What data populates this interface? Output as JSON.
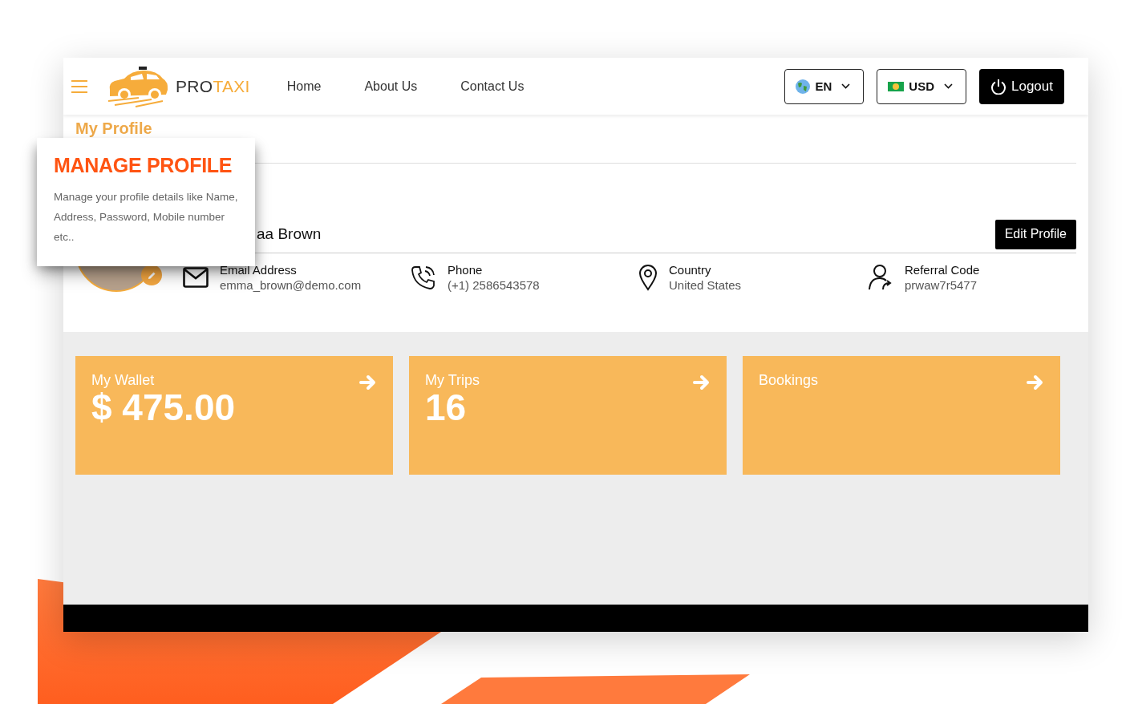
{
  "header": {
    "brand": {
      "part_1": "PRO",
      "part_2": "TAXI"
    },
    "nav": [
      "Home",
      "About Us",
      "Contact Us"
    ],
    "language": "EN",
    "currency": "USD",
    "logout": "Logout"
  },
  "page_title": "My Profile",
  "profile": {
    "name": "aa Brown",
    "edit_button": "Edit Profile",
    "details": [
      {
        "kind": "email",
        "label": "Email Address",
        "value": "emma_brown@demo.com"
      },
      {
        "kind": "phone",
        "label": "Phone",
        "value": "(+1) 2586543578"
      },
      {
        "kind": "country",
        "label": "Country",
        "value": "United States"
      },
      {
        "kind": "referral",
        "label": "Referral Code",
        "value": "prwaw7r5477"
      }
    ]
  },
  "cards": [
    {
      "title": "My Wallet",
      "value": "$ 475.00"
    },
    {
      "title": "My Trips",
      "value": "16"
    },
    {
      "title": "Bookings"
    }
  ],
  "callout": {
    "title": "MANAGE PROFILE",
    "text": "Manage your profile details like Name, Address, Password, Mobile number etc.."
  }
}
